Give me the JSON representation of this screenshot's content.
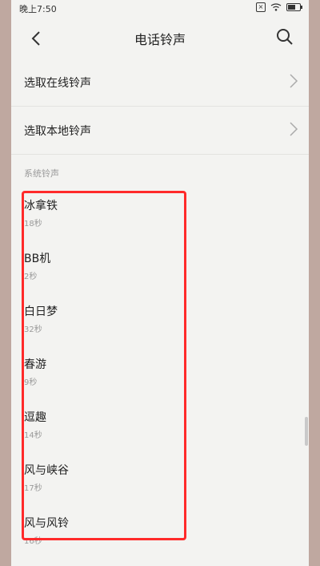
{
  "status_bar": {
    "time": "晚上7:50"
  },
  "header": {
    "title": "电话铃声"
  },
  "options": [
    {
      "label": "选取在线铃声"
    },
    {
      "label": "选取本地铃声"
    }
  ],
  "section_title": "系统铃声",
  "ringtones": [
    {
      "name": "冰拿铁",
      "duration": "18秒"
    },
    {
      "name": "BB机",
      "duration": "2秒"
    },
    {
      "name": "白日梦",
      "duration": "32秒"
    },
    {
      "name": "春游",
      "duration": "9秒"
    },
    {
      "name": "逗趣",
      "duration": "14秒"
    },
    {
      "name": "风与峡谷",
      "duration": "17秒"
    },
    {
      "name": "风与风铃",
      "duration": "16秒"
    }
  ],
  "colors": {
    "highlight": "#ff2a2a",
    "background": "#f3f3f1"
  }
}
